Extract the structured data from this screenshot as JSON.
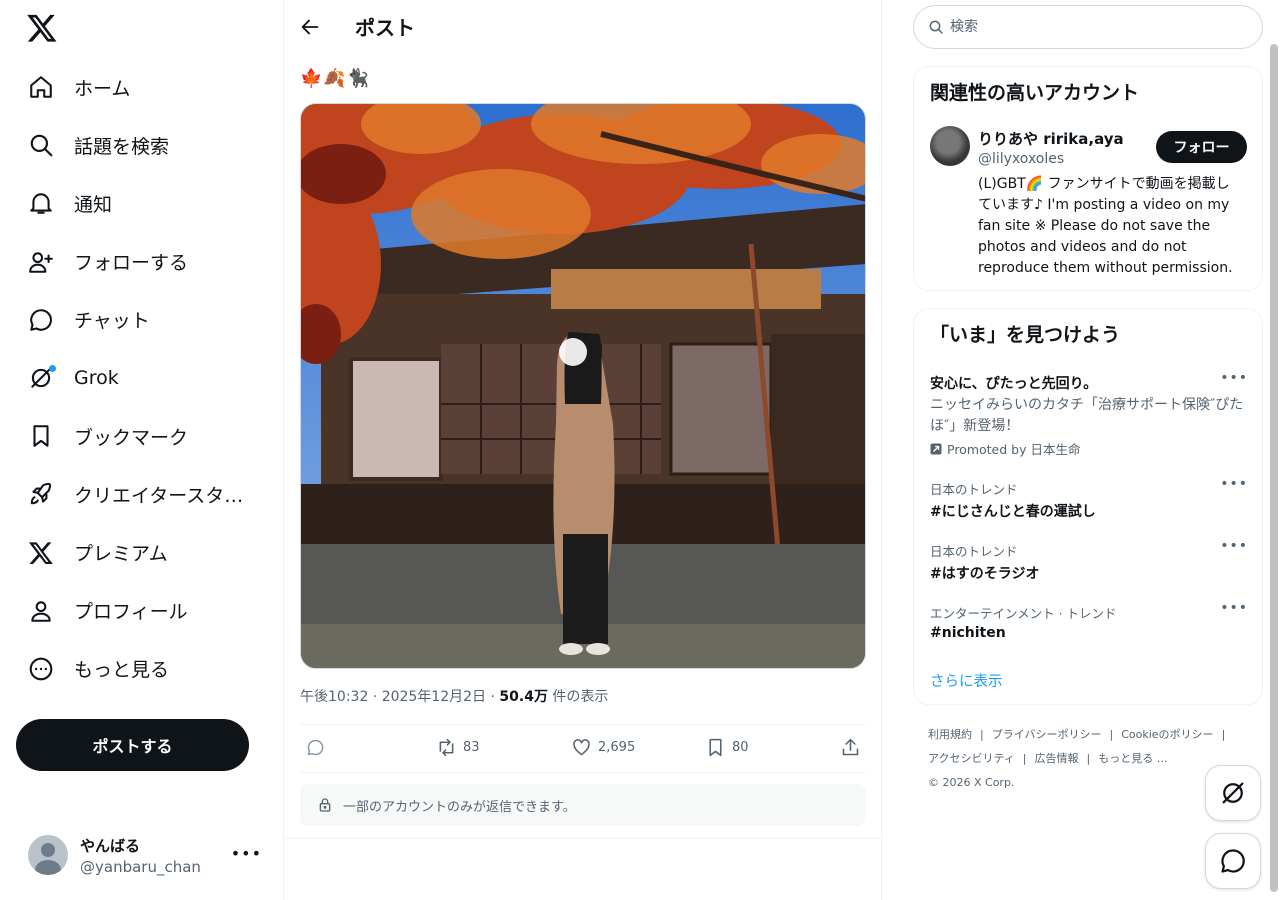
{
  "nav": {
    "items": [
      {
        "label": "ホーム",
        "icon": "home-icon"
      },
      {
        "label": "話題を検索",
        "icon": "search-icon"
      },
      {
        "label": "通知",
        "icon": "bell-icon"
      },
      {
        "label": "フォローする",
        "icon": "add-person-icon"
      },
      {
        "label": "チャット",
        "icon": "chat-icon"
      },
      {
        "label": "Grok",
        "icon": "grok-icon"
      },
      {
        "label": "ブックマーク",
        "icon": "bookmark-icon"
      },
      {
        "label": "クリエイタースタ…",
        "icon": "rocket-icon"
      },
      {
        "label": "プレミアム",
        "icon": "x-logo-icon"
      },
      {
        "label": "プロフィール",
        "icon": "person-icon"
      },
      {
        "label": "もっと見る",
        "icon": "more-circle-icon"
      }
    ],
    "post_button": "ポストする"
  },
  "account": {
    "name": "やんばる",
    "handle": "@yanbaru_chan"
  },
  "header": {
    "title": "ポスト"
  },
  "post": {
    "text": "🍁🍂🐈‍⬛",
    "time": "午後10:32 · 2025年12月2日 · ",
    "views_count": "50.4万",
    "views_label": " 件の表示",
    "retweets": "83",
    "likes": "2,695",
    "bookmarks": "80",
    "reply_restriction": "一部のアカウントのみが返信できます。"
  },
  "search": {
    "placeholder": "検索"
  },
  "recommend": {
    "title": "関連性の高いアカウント",
    "name": "りりあや ririka,aya",
    "handle": "@lilyxoxoles",
    "follow_label": "フォロー",
    "bio": "(L)GBT🌈 ファンサイトで動画を掲載しています♪ I'm posting a video on my fan site ※ Please do not save the photos and videos and do not reproduce them without permission."
  },
  "trends": {
    "title": "「いま」を見つけよう",
    "promo": {
      "title": "安心に、ぴたっと先回り。",
      "desc": "ニッセイみらいのカタチ「治療サポート保険″ぴたほ″」新登場！",
      "by": "Promoted by 日本生命"
    },
    "items": [
      {
        "context": "日本のトレンド",
        "name": "#にじさんじと春の運試し"
      },
      {
        "context": "日本のトレンド",
        "name": "#はすのそラジオ"
      },
      {
        "context": "エンターテインメント · トレンド",
        "name": "#nichiten"
      }
    ],
    "show_more": "さらに表示"
  },
  "footer": {
    "links": [
      "利用規約",
      "プライバシーポリシー",
      "Cookieのポリシー",
      "アクセシビリティ",
      "広告情報",
      "もっと見る …"
    ],
    "copyright": "© 2026 X Corp."
  },
  "colors": {
    "accent": "#1d9bf0",
    "text": "#0f1419",
    "muted": "#536471",
    "border": "#eff3f4"
  }
}
